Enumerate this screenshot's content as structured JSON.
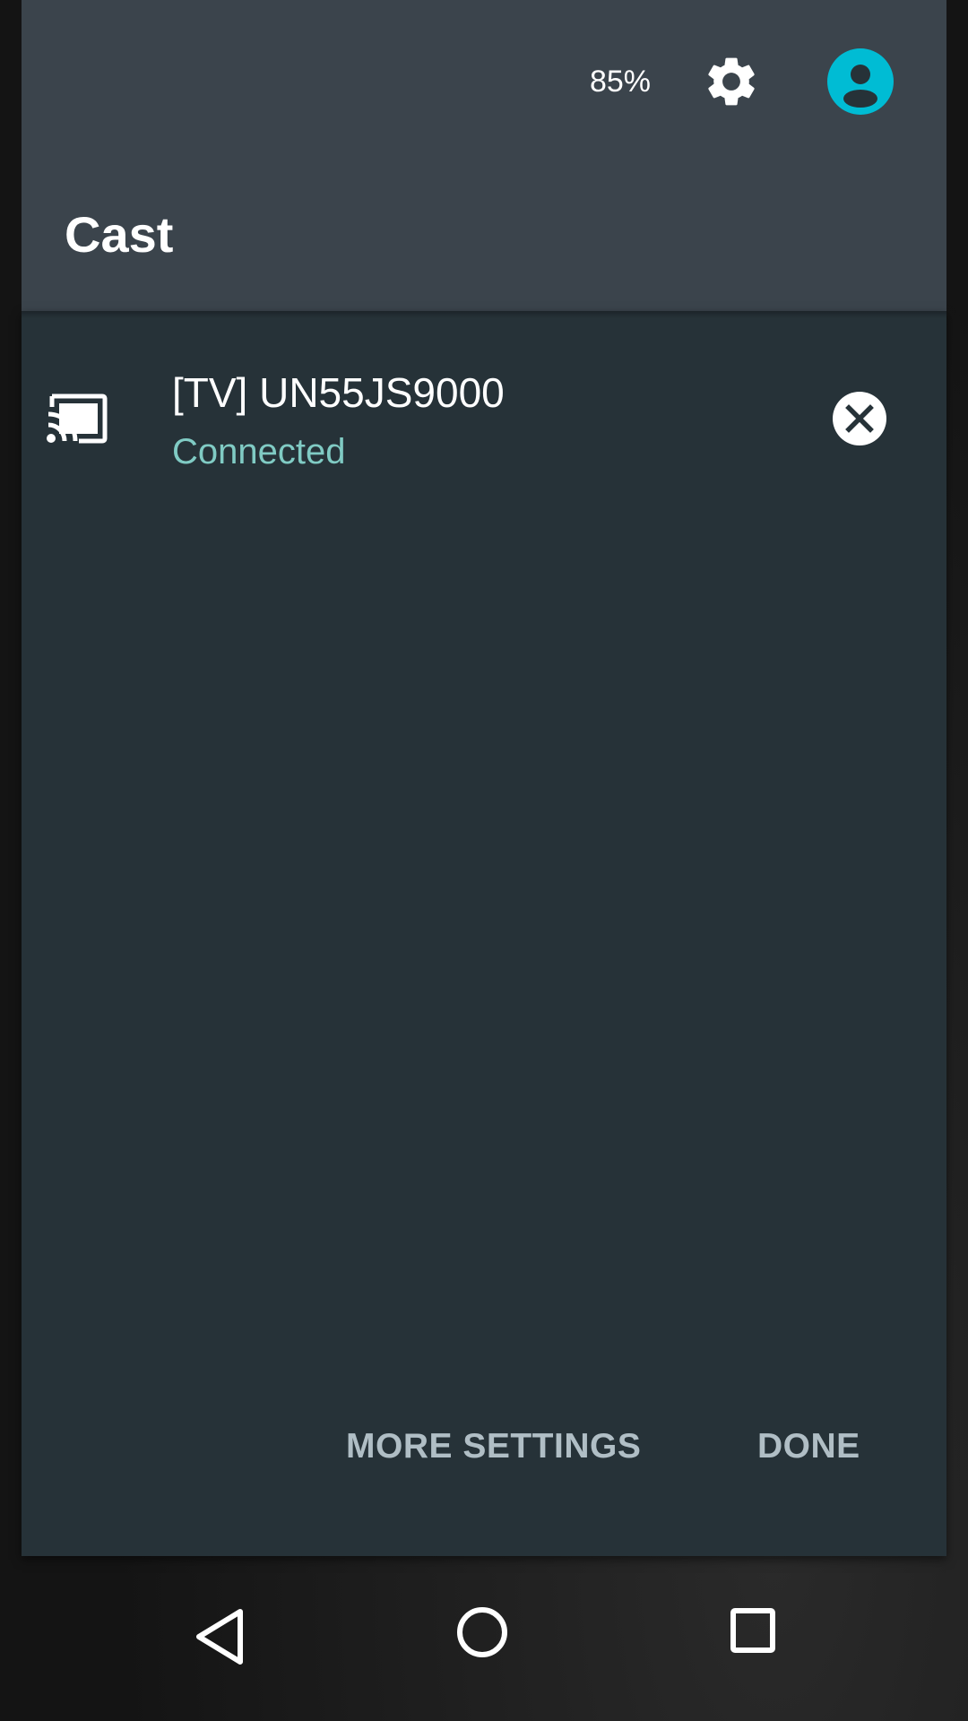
{
  "status": {
    "battery_percent": "85%"
  },
  "header": {
    "title": "Cast",
    "icons": [
      "gear-icon",
      "account-avatar-icon"
    ]
  },
  "devices": [
    {
      "name": "[TV] UN55JS9000",
      "status": "Connected",
      "icon": "cast-connected-icon",
      "action_icon": "close-circle-icon"
    }
  ],
  "actions": {
    "more_settings": "MORE SETTINGS",
    "done": "DONE"
  },
  "navbar": {
    "icons": [
      "back-triangle-icon",
      "home-circle-icon",
      "recents-square-icon"
    ]
  },
  "colors": {
    "header_bg": "#3b444c",
    "body_bg": "#263238",
    "status_accent": "#80cbc4",
    "avatar_accent": "#00bcd4",
    "button_text": "#b0bec5"
  }
}
